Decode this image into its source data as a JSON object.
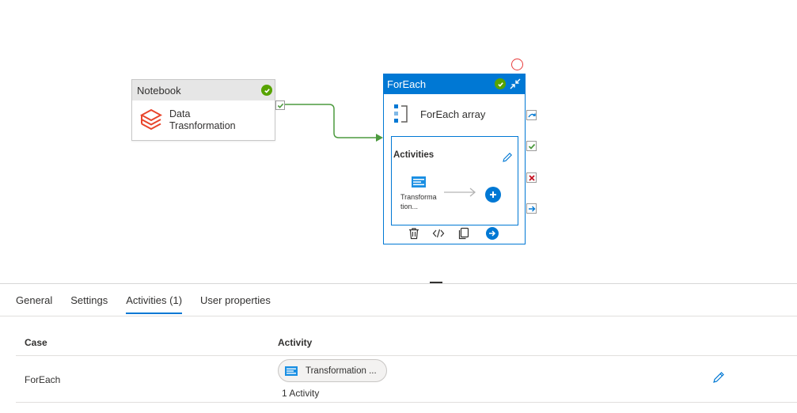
{
  "canvas": {
    "notebook_node": {
      "header": "Notebook",
      "label_line1": "Data",
      "label_line2": "Trasnformation",
      "status_icon": "success-check-icon",
      "icon": "databricks-icon"
    },
    "foreach_node": {
      "header": "ForEach",
      "subtitle": "ForEach array",
      "activities_title": "Activities",
      "inner_activity_line1": "Transforma",
      "inner_activity_line2": "tion...",
      "status_icon": "success-check-icon"
    },
    "colors": {
      "accent": "#0078d4",
      "success": "#57a300",
      "failure": "#c50f1f",
      "connector": "#4c9a3e"
    }
  },
  "tabs": [
    {
      "label": "General"
    },
    {
      "label": "Settings"
    },
    {
      "label": "Activities (1)",
      "active": true
    },
    {
      "label": "User properties"
    }
  ],
  "table": {
    "headers": {
      "case": "Case",
      "activity": "Activity"
    },
    "rows": [
      {
        "case": "ForEach",
        "activity_pill": "Transformation ...",
        "activity_count": "1 Activity"
      }
    ]
  }
}
